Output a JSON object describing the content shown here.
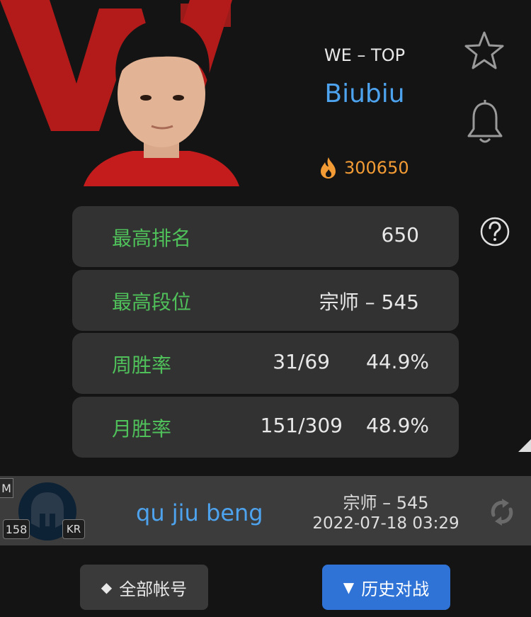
{
  "player": {
    "team_role": "WE – TOP",
    "name": "Biubiu",
    "hot_value": "300650"
  },
  "stats": [
    {
      "label": "最高排名",
      "value": "650"
    },
    {
      "label": "最高段位",
      "value": "宗师 – 545"
    },
    {
      "label": "周胜率",
      "games": "31/69",
      "rate": "44.9%"
    },
    {
      "label": "月胜率",
      "games": "151/309",
      "rate": "48.9%"
    }
  ],
  "account": {
    "tag": "M",
    "level": "158",
    "region": "KR",
    "name": "qu jiu beng",
    "rank": "宗师 – 545",
    "updated": "2022-07-18 03:29"
  },
  "buttons": {
    "all_accounts": "全部帐号",
    "all_accounts_glyph": "◆",
    "history": "历史对战",
    "history_glyph": "▼"
  },
  "colors": {
    "background": "#141414",
    "card": "#323232",
    "label_green": "#4fc05a",
    "name_blue": "#4ea3ee",
    "hot_orange": "#f39b34",
    "accent_button": "#2f73d6",
    "team_logo_red": "#b31b1b"
  },
  "icons": {
    "favorite": "star-outline-icon",
    "notify": "bell-outline-icon",
    "help": "question-circle-icon",
    "hot": "flame-icon",
    "refresh": "refresh-icon",
    "avatar": "spartan-helmet-icon"
  }
}
